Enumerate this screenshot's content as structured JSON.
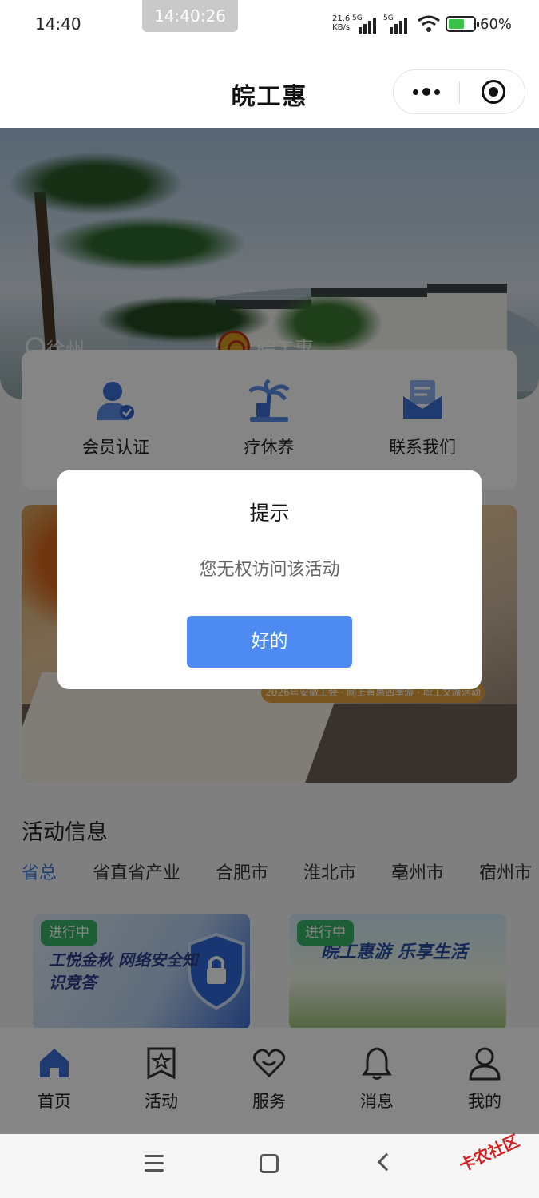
{
  "status_bar": {
    "time": "14:40",
    "screenshot_time": "14:40:26",
    "speed": "21.6",
    "speed_unit": "KB/s",
    "net1": "5G",
    "net2": "5G",
    "battery": "60%"
  },
  "header": {
    "title": "皖工惠"
  },
  "hero": {
    "location": "徐州",
    "brand": "皖工惠"
  },
  "quick_actions": [
    {
      "label": "会员认证",
      "icon": "member-verify-icon"
    },
    {
      "label": "疗休养",
      "icon": "palm-tree-icon"
    },
    {
      "label": "联系我们",
      "icon": "mail-icon"
    }
  ],
  "banner": {
    "tag": "2026年安徽工会 · 网上普惠四季游 · 职工文旅活动"
  },
  "activity": {
    "title": "活动信息",
    "tabs": [
      "省总",
      "省直省产业",
      "合肥市",
      "淮北市",
      "亳州市",
      "宿州市"
    ],
    "active_tab": 0,
    "cards": [
      {
        "status": "进行中",
        "text": "工悦金秋 网络安全知识竞答"
      },
      {
        "status": "进行中",
        "text": "皖工惠游 乐享生活"
      }
    ]
  },
  "tab_bar": [
    {
      "label": "首页",
      "icon": "home-icon"
    },
    {
      "label": "活动",
      "icon": "activity-star-icon"
    },
    {
      "label": "服务",
      "icon": "heart-icon"
    },
    {
      "label": "消息",
      "icon": "bell-icon"
    },
    {
      "label": "我的",
      "icon": "user-icon"
    }
  ],
  "dialog": {
    "title": "提示",
    "message": "您无权访问该活动",
    "confirm": "好的"
  },
  "watermark": "卡农社区",
  "colors": {
    "accent": "#4d8bf3",
    "tab_active": "#3d7bdc",
    "badge_green": "#39b56a"
  }
}
